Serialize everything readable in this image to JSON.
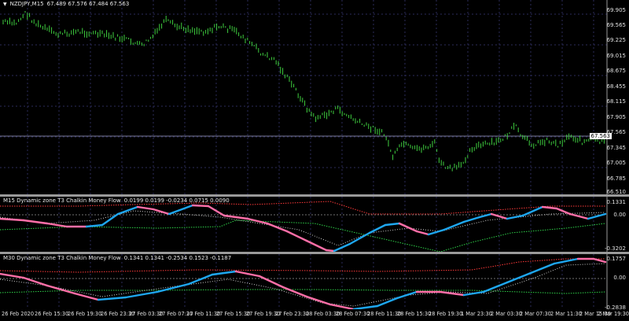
{
  "main_chart": {
    "symbol": "NZDJPY,M15",
    "ohlc": "67.489 67.576 67.484 67.563",
    "price_scale": [
      "69.905",
      "69.565",
      "69.225",
      "69.015",
      "68.675",
      "68.455",
      "68.115",
      "67.905",
      "67.565",
      "67.345",
      "67.005",
      "66.785",
      "66.510"
    ],
    "current_price": "67.563",
    "dropdown_icon": "triangle-down-icon"
  },
  "indicator_m15": {
    "title": "M15 Dynamic zone T3 Chalkin Money Flow",
    "values": "0.0199 0.0199 -0.0234 0.0715 0.0090",
    "scale": [
      "0.1331",
      "0.00",
      "-0.3202"
    ]
  },
  "indicator_m30": {
    "title": "M30 Dynamic zone T3 Chalkin Money Flow",
    "values": "0.1341 0.1341 -0.2534 0.1523 -0.1187",
    "scale": [
      "0.1757",
      "0.00",
      "-0.2838"
    ]
  },
  "time_axis": [
    "26 Feb 2020",
    "26 Feb 15:30",
    "26 Feb 19:30",
    "26 Feb 23:30",
    "27 Feb 03:30",
    "27 Feb 07:30",
    "27 Feb 11:30",
    "27 Feb 15:30",
    "27 Feb 19:30",
    "27 Feb 23:30",
    "28 Feb 03:30",
    "28 Feb 07:30",
    "28 Feb 11:30",
    "28 Feb 15:30",
    "28 Feb 19:30",
    "1 Mar 23:30",
    "2 Mar 03:30",
    "2 Mar 07:30",
    "2 Mar 11:30",
    "2 Mar 15:30",
    "2 Mar 19:30"
  ],
  "colors": {
    "candle": "#3fcf3f",
    "grid": "#2b2b5a",
    "up_line": "#1ea7f0",
    "down_line": "#ff6fa8",
    "upper_zone": "#ff3a3a",
    "lower_zone": "#2fd34a"
  }
}
